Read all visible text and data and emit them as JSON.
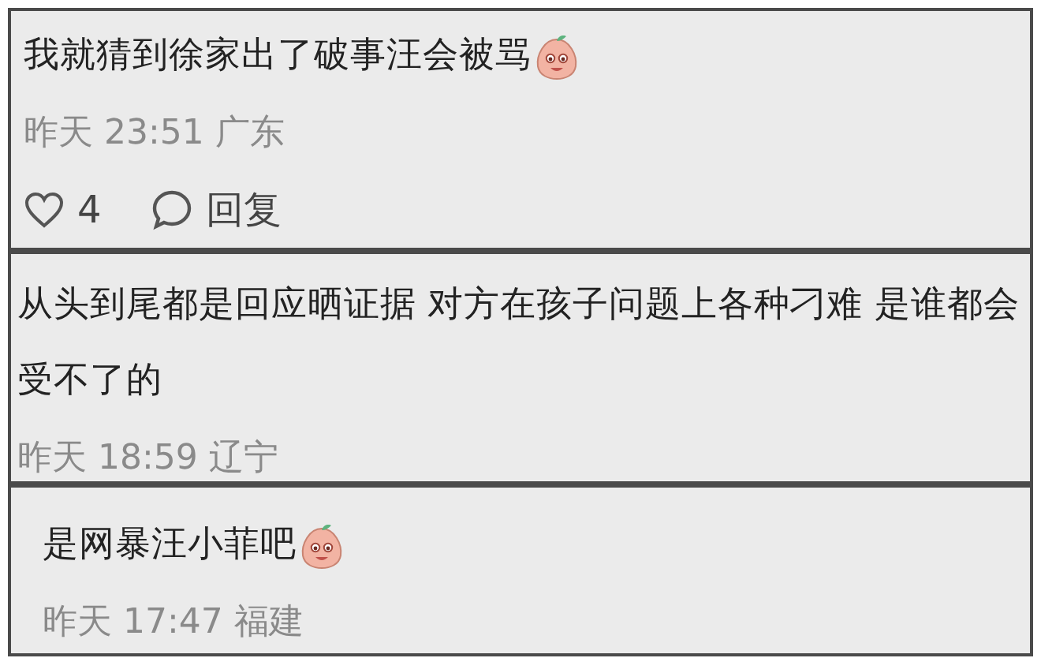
{
  "comments": [
    {
      "text": "我就猜到徐家出了破事汪会被骂",
      "emoji": true,
      "time": "昨天 23:51 广东",
      "actions": {
        "likes": "4",
        "reply": "回复"
      }
    },
    {
      "text": "从头到尾都是回应晒证据 对方在孩子问题上各种刁难 是谁都会受不了的",
      "emoji": false,
      "time": "昨天 18:59 辽宁"
    },
    {
      "text": "是网暴汪小菲吧",
      "emoji": true,
      "time": "昨天 17:47 福建"
    }
  ]
}
